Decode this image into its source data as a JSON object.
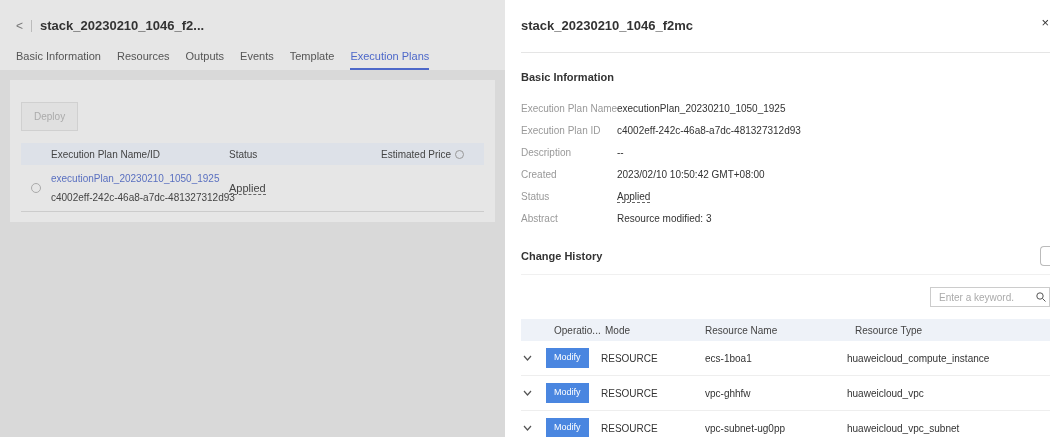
{
  "page": {
    "back": "<",
    "title": "stack_20230210_1046_f2...",
    "tabs": [
      {
        "label": "Basic Information",
        "selected": false
      },
      {
        "label": "Resources",
        "selected": false
      },
      {
        "label": "Outputs",
        "selected": false
      },
      {
        "label": "Events",
        "selected": false
      },
      {
        "label": "Template",
        "selected": false
      },
      {
        "label": "Execution Plans",
        "selected": true
      }
    ],
    "deploy_button": {
      "label": "Deploy",
      "disabled": true
    },
    "table": {
      "columns": [
        "Execution Plan Name/ID",
        "Status",
        "Estimated Price"
      ],
      "rows": [
        {
          "name": "executionPlan_20230210_1050_1925",
          "id": "c4002eff-242c-46a8-a7dc-481327312d93",
          "status": "Applied",
          "selected": false
        }
      ]
    }
  },
  "drawer": {
    "title": "stack_20230210_1046_f2mc",
    "close": "×",
    "basic_heading": "Basic Information",
    "fields": [
      {
        "label": "Execution Plan Name",
        "value": "executionPlan_20230210_1050_1925"
      },
      {
        "label": "Execution Plan ID",
        "value": "c4002eff-242c-46a8-a7dc-481327312d93"
      },
      {
        "label": "Description",
        "value": "--"
      },
      {
        "label": "Created",
        "value": "2023/02/10 10:50:42 GMT+08:00"
      },
      {
        "label": "Status",
        "value": "Applied",
        "kind": "status"
      },
      {
        "label": "Abstract",
        "value": "Resource modified: 3"
      }
    ],
    "history_heading": "Change History",
    "search": {
      "placeholder": "Enter a keyword."
    },
    "columns": [
      "Operatio...",
      "Mode",
      "Resource Name",
      "Resource Type"
    ],
    "rows": [
      {
        "expanded": false,
        "operation": "Modify",
        "mode": "RESOURCE",
        "name": "ecs-1boa1",
        "type": "huaweicloud_compute_instance"
      },
      {
        "expanded": false,
        "operation": "Modify",
        "mode": "RESOURCE",
        "name": "vpc-ghhfw",
        "type": "huaweicloud_vpc"
      },
      {
        "expanded": false,
        "operation": "Modify",
        "mode": "RESOURCE",
        "name": "vpc-subnet-ug0pp",
        "type": "huaweicloud_vpc_subnet"
      }
    ]
  }
}
